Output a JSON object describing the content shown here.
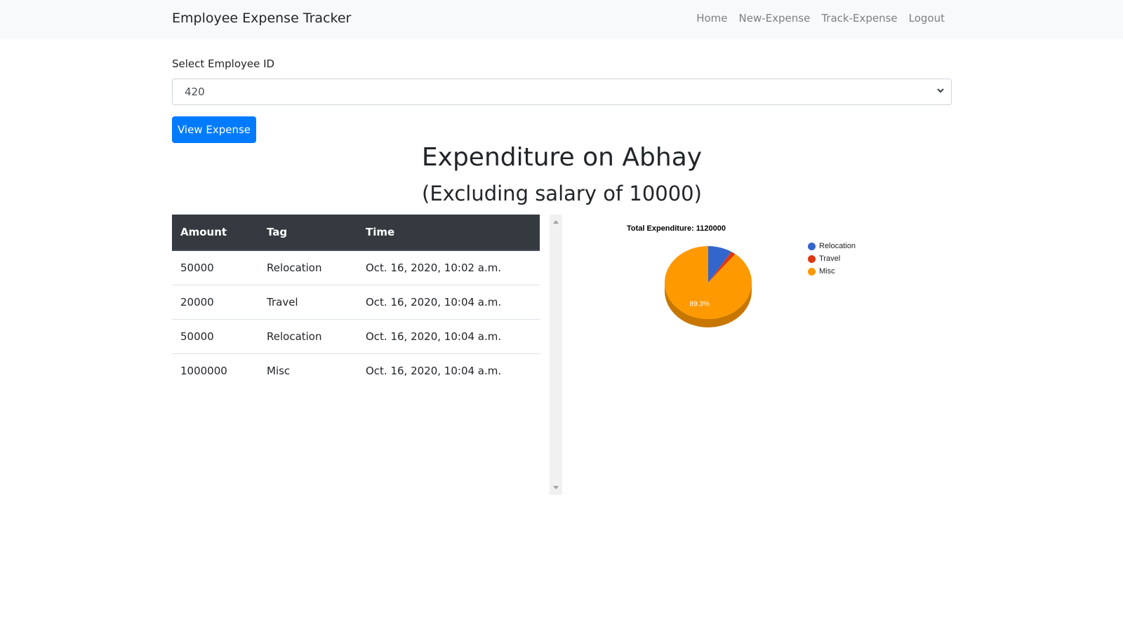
{
  "navbar": {
    "brand": "Employee Expense Tracker",
    "links": [
      "Home",
      "New-Expense",
      "Track-Expense",
      "Logout"
    ]
  },
  "form": {
    "label": "Select Employee ID",
    "selected_value": "420",
    "button_label": "View Expense"
  },
  "heading": {
    "title": "Expenditure on Abhay",
    "subtitle": "(Excluding salary of 10000)"
  },
  "table": {
    "headers": [
      "Amount",
      "Tag",
      "Time"
    ],
    "rows": [
      [
        "50000",
        "Relocation",
        "Oct. 16, 2020, 10:02 a.m."
      ],
      [
        "20000",
        "Travel",
        "Oct. 16, 2020, 10:04 a.m."
      ],
      [
        "50000",
        "Relocation",
        "Oct. 16, 2020, 10:04 a.m."
      ],
      [
        "1000000",
        "Misc",
        "Oct. 16, 2020, 10:04 a.m."
      ]
    ]
  },
  "colors": {
    "accent": "#007bff",
    "table_header": "#343a40",
    "relocation": "#3366cc",
    "travel": "#dc3912",
    "misc": "#ff9900"
  },
  "chart_data": {
    "type": "pie",
    "title": "Total Expenditure: 1120000",
    "is_3d": true,
    "legend_position": "right",
    "categories": [
      "Relocation",
      "Travel",
      "Misc"
    ],
    "values": [
      100000,
      20000,
      1000000
    ],
    "colors": [
      "#3366cc",
      "#dc3912",
      "#ff9900"
    ],
    "slice_labels": [
      "",
      "",
      "89.3%"
    ]
  }
}
